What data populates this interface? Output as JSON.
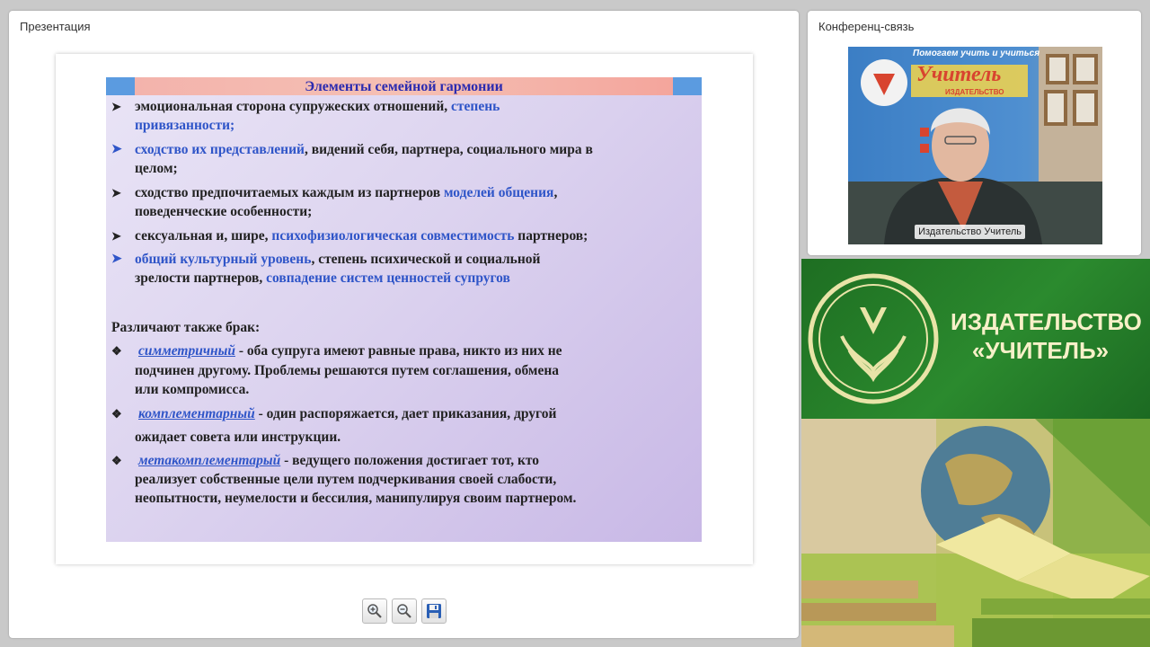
{
  "presentation": {
    "title": "Презентация",
    "slide": {
      "heading": "Элементы  семейной гармонии",
      "b1_a": "эмоциональная сторона супружеских отношений, ",
      "b1_b": "степень",
      "b1_c": "привязанности;",
      "b2_a": "сходство их представлений",
      "b2_b": ", видений себя, партнера, социального мира в",
      "b2_c": "целом;",
      "b3_a": "сходство предпочитаемых каждым из партнеров ",
      "b3_b": "моделей общения",
      "b3_c": ",",
      "b3_d": "поведенческие особенности;",
      "b4_a": "сексуальная и, шире, ",
      "b4_b": "психофизиологическая совместимость",
      "b4_c": " партнеров;",
      "b5_a": "общий культурный уровень",
      "b5_b": ", степень психической и социальной",
      "b5_c": "зрелости партнеров, ",
      "b5_d": "совпадение систем ценностей супругов",
      "sub_heading": "Различают также брак:",
      "m1_term": "симметричный",
      "m1_l1": " -  оба супруга имеют  равные права, никто из них не",
      "m1_l2": "подчинен другому. Проблемы решаются путем соглашения, обмена",
      "m1_l3": "или компромисса.",
      "m2_term": "комплементарный",
      "m2_l1": "  - один распоряжается, дает приказания, другой",
      "m2_l2": "ожидает совета или инструкции.",
      "m3_term": "метакомплементарый",
      "m3_l1": "  -    ведущего положения достигает тот, кто",
      "m3_l2": "реализует собственные цели путем подчеркивания своей слабости,",
      "m3_l3": "неопытности, неумелости и бессилия, манипулируя своим партнером."
    },
    "toolbar": {
      "zoom_in_icon": "zoom-in-icon",
      "zoom_out_icon": "zoom-out-icon",
      "save_icon": "save-icon"
    }
  },
  "conference": {
    "title": "Конференц-связь",
    "video_label": "Издательство Учитель",
    "backdrop_text": {
      "slogan": "Помогаем учить и учиться",
      "brand": "Учитель",
      "sub": "ИЗДАТЕЛЬСТВО"
    }
  },
  "banner": {
    "line1": "ИЗДАТЕЛЬСТВО",
    "line2": "«УЧИТЕЛЬ»"
  },
  "colors": {
    "accent_blue": "#2f55c8",
    "banner_green": "#2b8a2e",
    "banner_text": "#f7f0c8"
  }
}
